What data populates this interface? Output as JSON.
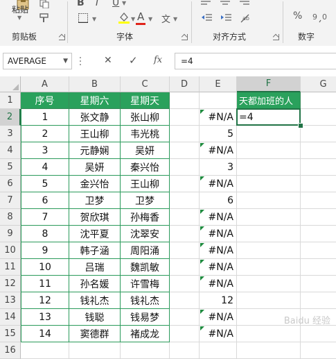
{
  "ribbon": {
    "paste_label": "粘贴",
    "groups": {
      "clipboard": "剪贴板",
      "font": "字体",
      "alignment": "对齐方式",
      "number": "数字"
    },
    "bold_glyph": "B",
    "italic_glyph": "I",
    "underline_glyph": "U",
    "fontcolor_glyph": "A",
    "charformat_glyph": "文",
    "percent_glyph": "%"
  },
  "formula_bar": {
    "name_box": "AVERAGE",
    "cancel_glyph": "✕",
    "enter_glyph": "✓",
    "fx_label": "fx",
    "formula": "=4"
  },
  "grid": {
    "columns": [
      "A",
      "B",
      "C",
      "D",
      "E",
      "F",
      "G"
    ],
    "rows": [
      "1",
      "2",
      "3",
      "4",
      "5",
      "6",
      "7",
      "8",
      "9",
      "10",
      "11",
      "12",
      "13",
      "14",
      "15",
      "16"
    ],
    "header_row": {
      "A": "序号",
      "B": "星期六",
      "C": "星期天",
      "F": "天都加班的人"
    },
    "table_rows": [
      {
        "a": "1",
        "b": "张文静",
        "c": "张山柳",
        "e": "#N/A",
        "f": "=4"
      },
      {
        "a": "2",
        "b": "王山柳",
        "c": "韦光桃",
        "e": "5",
        "f": ""
      },
      {
        "a": "3",
        "b": "元静娴",
        "c": "吴妍",
        "e": "#N/A",
        "f": ""
      },
      {
        "a": "4",
        "b": "吴妍",
        "c": "秦兴怡",
        "e": "3",
        "f": ""
      },
      {
        "a": "5",
        "b": "金兴怡",
        "c": "王山柳",
        "e": "#N/A",
        "f": ""
      },
      {
        "a": "6",
        "b": "卫梦",
        "c": "卫梦",
        "e": "6",
        "f": ""
      },
      {
        "a": "7",
        "b": "贺欣琪",
        "c": "孙梅香",
        "e": "#N/A",
        "f": ""
      },
      {
        "a": "8",
        "b": "沈平夏",
        "c": "沈翠安",
        "e": "#N/A",
        "f": ""
      },
      {
        "a": "9",
        "b": "韩子涵",
        "c": "周阳涌",
        "e": "#N/A",
        "f": ""
      },
      {
        "a": "10",
        "b": "吕瑞",
        "c": "魏凯敏",
        "e": "#N/A",
        "f": ""
      },
      {
        "a": "11",
        "b": "孙名媛",
        "c": "许雪梅",
        "e": "#N/A",
        "f": ""
      },
      {
        "a": "12",
        "b": "钱礼杰",
        "c": "钱礼杰",
        "e": "12",
        "f": ""
      },
      {
        "a": "13",
        "b": "钱聪",
        "c": "钱易梦",
        "e": "#N/A",
        "f": ""
      },
      {
        "a": "14",
        "b": "窦德群",
        "c": "褚成龙",
        "e": "#N/A",
        "f": ""
      }
    ],
    "active_cell": "F2",
    "colors": {
      "header_fill": "#2aa15c",
      "accent": "#217346",
      "error_marker": "#1e8a3e"
    }
  },
  "watermark": "Baidu 经验"
}
